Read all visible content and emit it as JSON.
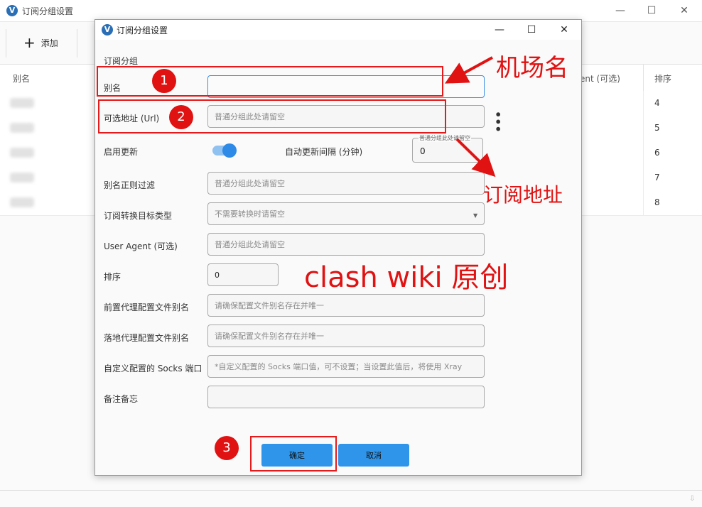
{
  "window": {
    "title": "订阅分组设置",
    "logo_letter": "V"
  },
  "toolbar": {
    "add_label": "添加"
  },
  "table": {
    "headers": {
      "alias": "别名",
      "user_agent": "ent (可选)",
      "sort": "排序"
    },
    "rows": [
      {
        "sort": "4"
      },
      {
        "sort": "5"
      },
      {
        "sort": "6"
      },
      {
        "sort": "7"
      },
      {
        "sort": "8"
      }
    ]
  },
  "dialog": {
    "title": "订阅分组设置",
    "section": "订阅分组",
    "fields": {
      "alias": {
        "label": "别名",
        "value": "",
        "placeholder": ""
      },
      "url": {
        "label": "可选地址 (Url)",
        "placeholder": "普通分组此处请留空"
      },
      "enable_update": {
        "label": "启用更新",
        "on": true
      },
      "auto_interval": {
        "label": "自动更新间隔 (分钟)",
        "hint": "普通分组此处请留空",
        "value": "0"
      },
      "alias_filter": {
        "label": "别名正则过滤",
        "placeholder": "普通分组此处请留空"
      },
      "convert_target": {
        "label": "订阅转换目标类型",
        "placeholder": "不需要转换时请留空"
      },
      "user_agent": {
        "label": "User Agent (可选)",
        "placeholder": "普通分组此处请留空"
      },
      "sort": {
        "label": "排序",
        "value": "0"
      },
      "prev_proxy": {
        "label": "前置代理配置文件别名",
        "placeholder": "请确保配置文件别名存在并唯一"
      },
      "next_proxy": {
        "label": "落地代理配置文件别名",
        "placeholder": "请确保配置文件别名存在并唯一"
      },
      "socks_port": {
        "label": "自定义配置的 Socks 端口",
        "placeholder": "*自定义配置的 Socks 端口值，可不设置；当设置此值后，将使用 Xray"
      },
      "memo": {
        "label": "备注备忘",
        "value": ""
      }
    },
    "buttons": {
      "ok": "确定",
      "cancel": "取消"
    }
  },
  "annotations": {
    "badge1": "1",
    "badge2": "2",
    "badge3": "3",
    "label1": "机场名",
    "label2": "订阅地址",
    "watermark": "clash wiki 原创",
    "color": "#e01212"
  },
  "colors": {
    "accent": "#2f95ea",
    "focus_border": "#3a8de0"
  }
}
